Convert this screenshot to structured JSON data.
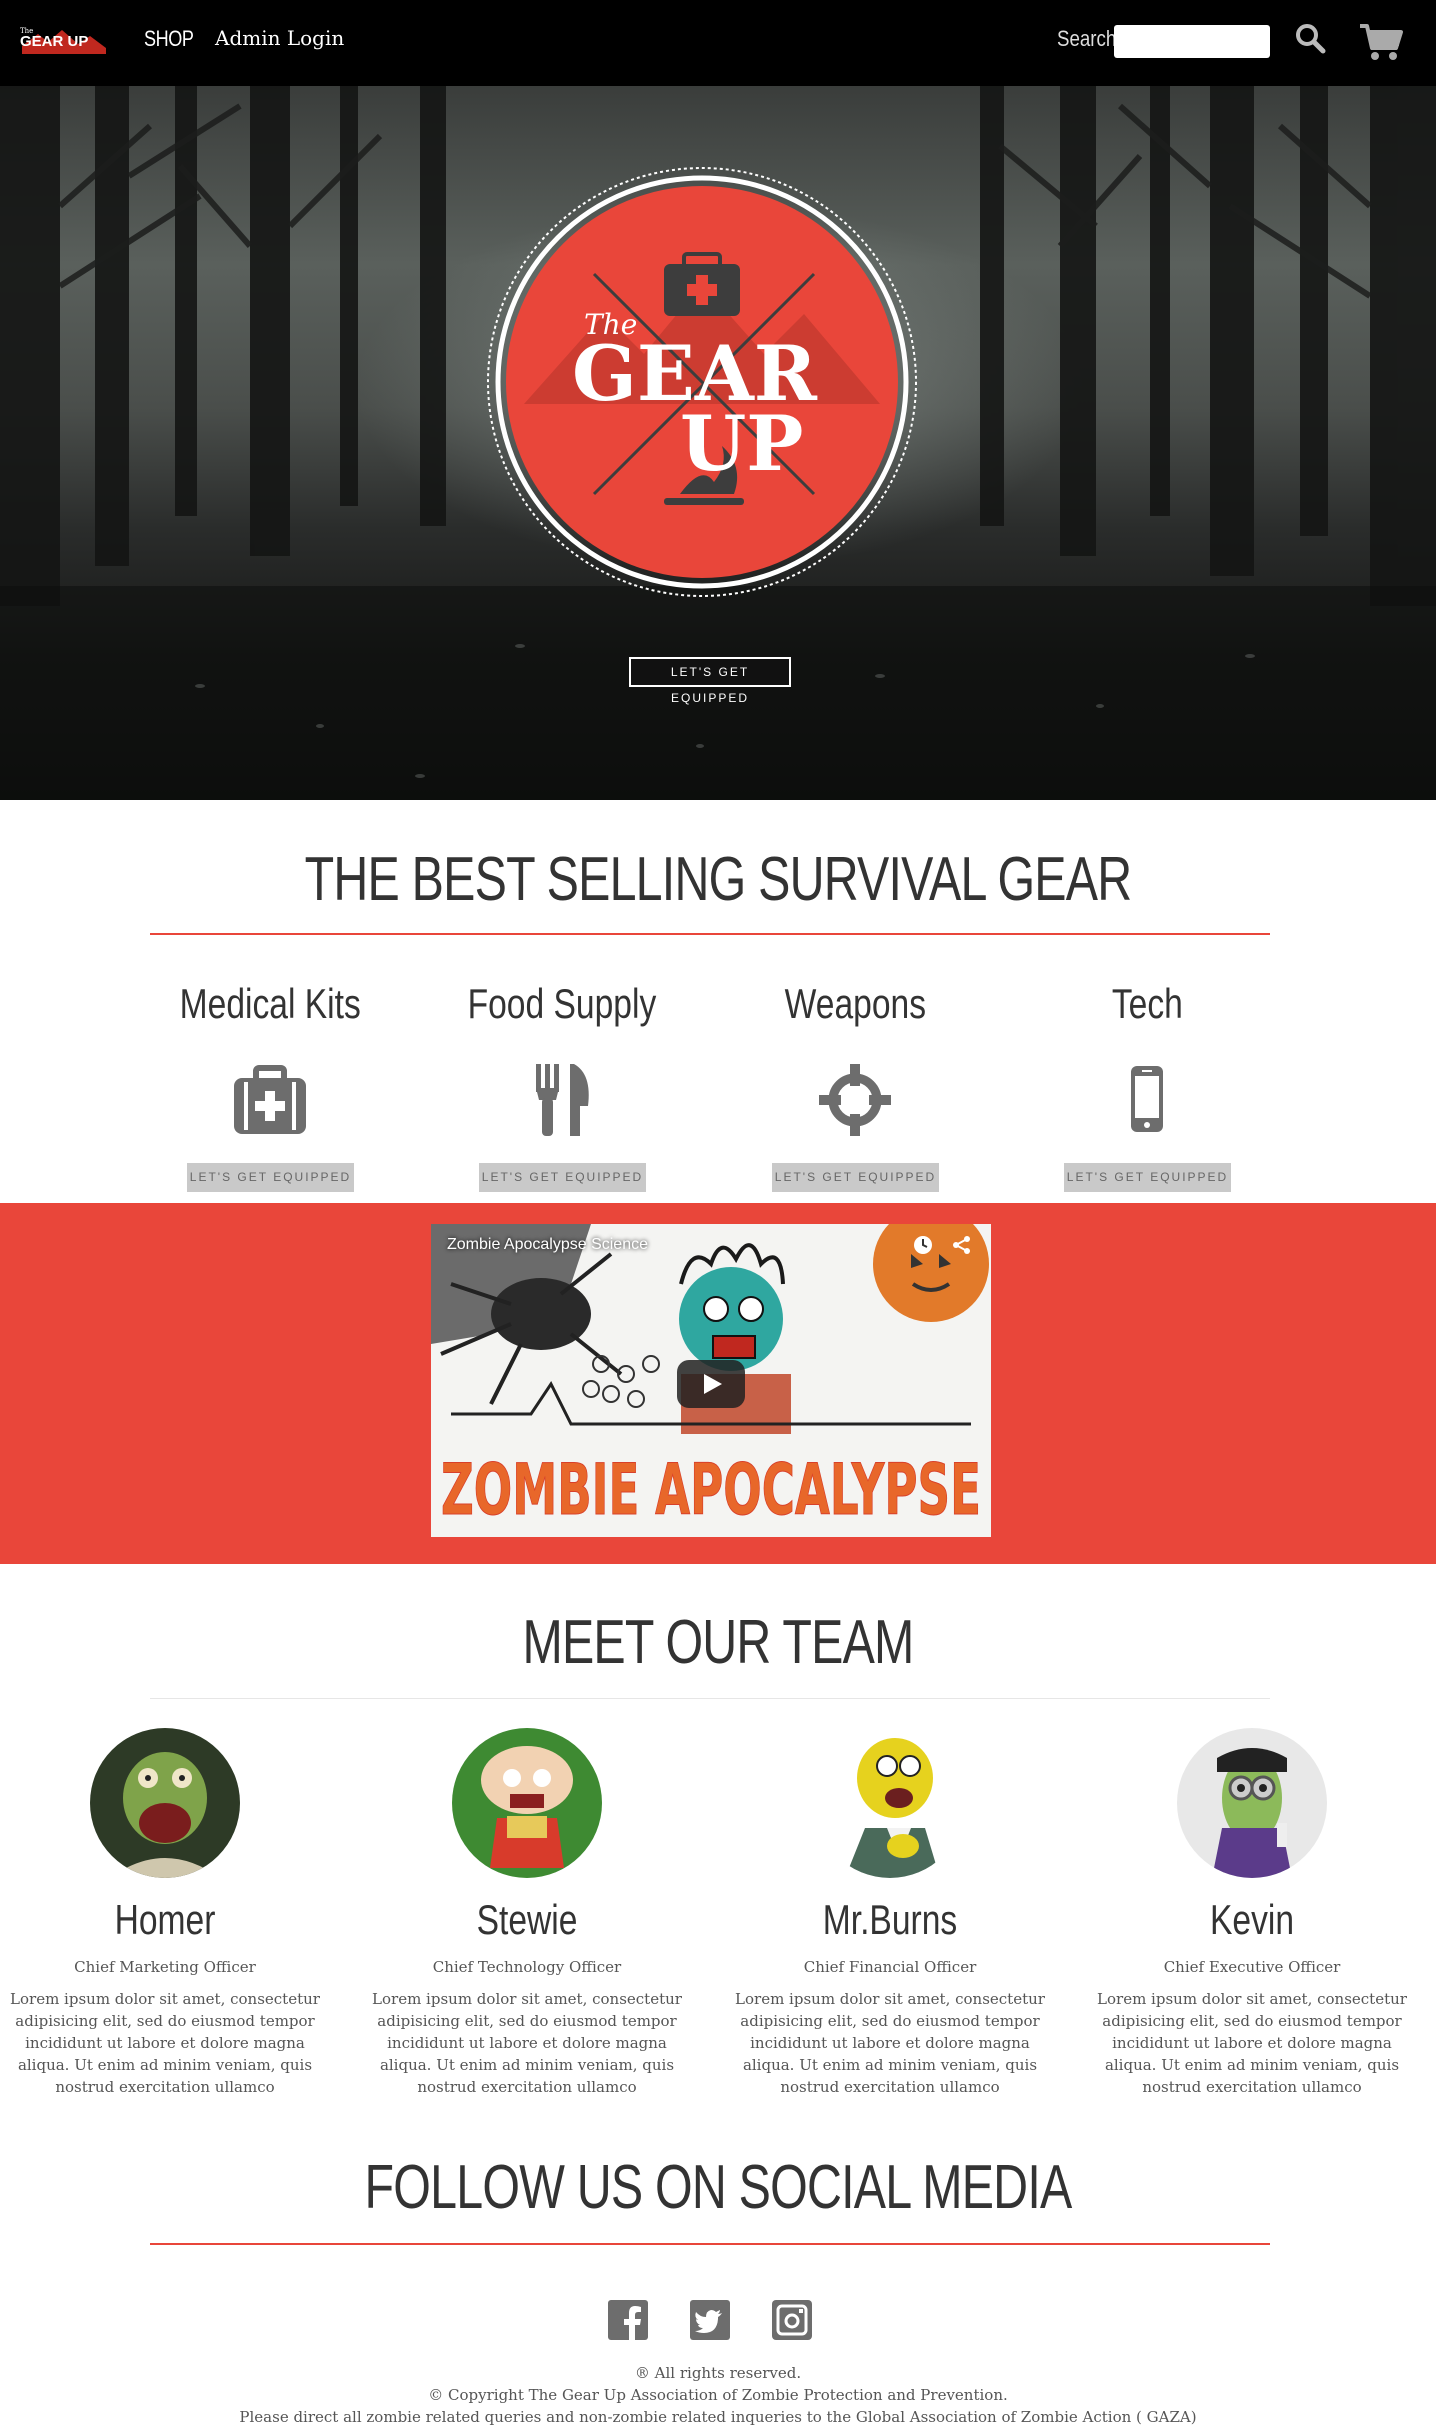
{
  "nav": {
    "logo_text": "GEAR UP",
    "logo_small": "The",
    "shop": "SHOP",
    "admin": "Admin Login",
    "search_label": "Search",
    "search_placeholder": ""
  },
  "hero": {
    "emblem_small": "The",
    "emblem_line1": "GEAR",
    "emblem_line2": "UP",
    "cta": "LET'S GET EQUIPPED"
  },
  "best_selling": {
    "heading": "THE BEST SELLING SURVIVAL GEAR",
    "categories": [
      {
        "title": "Medical Kits",
        "icon": "medkit-icon",
        "button": "LET'S GET EQUIPPED"
      },
      {
        "title": "Food Supply",
        "icon": "fork-knife-icon",
        "button": "LET'S GET EQUIPPED"
      },
      {
        "title": "Weapons",
        "icon": "crosshair-icon",
        "button": "LET'S GET EQUIPPED"
      },
      {
        "title": "Tech",
        "icon": "phone-icon",
        "button": "LET'S GET EQUIPPED"
      }
    ]
  },
  "video": {
    "title": "Zombie Apocalypse Science",
    "art_text": "ZOMBIE APOCALYPSE"
  },
  "team": {
    "heading": "MEET OUR TEAM",
    "members": [
      {
        "name": "Homer",
        "role": "Chief Marketing Officer",
        "bio": "Lorem ipsum dolor sit amet, consectetur adipisicing elit, sed do eiusmod tempor incididunt ut labore et dolore magna aliqua. Ut enim ad minim veniam, quis nostrud exercitation ullamco"
      },
      {
        "name": "Stewie",
        "role": "Chief Technology Officer",
        "bio": "Lorem ipsum dolor sit amet, consectetur adipisicing elit, sed do eiusmod tempor incididunt ut labore et dolore magna aliqua. Ut enim ad minim veniam, quis nostrud exercitation ullamco"
      },
      {
        "name": "Mr.Burns",
        "role": "Chief Financial Officer",
        "bio": "Lorem ipsum dolor sit amet, consectetur adipisicing elit, sed do eiusmod tempor incididunt ut labore et dolore magna aliqua. Ut enim ad minim veniam, quis nostrud exercitation ullamco"
      },
      {
        "name": "Kevin",
        "role": "Chief Executive Officer",
        "bio": "Lorem ipsum dolor sit amet, consectetur adipisicing elit, sed do eiusmod tempor incididunt ut labore et dolore magna aliqua. Ut enim ad minim veniam, quis nostrud exercitation ullamco"
      }
    ]
  },
  "social": {
    "heading": "FOLLOW US ON SOCIAL MEDIA",
    "icons": [
      "facebook-icon",
      "twitter-icon",
      "instagram-icon"
    ]
  },
  "footer": {
    "rights": "® All rights reserved.",
    "copyright": "© Copyright The Gear Up Association of Zombie Protection and Prevention.",
    "contact": "Please direct all zombie related queries and non-zombie related inqueries to the Global Association of Zombie Action ( GAZA)"
  },
  "colors": {
    "accent": "#e9463a",
    "navbar": "#000000",
    "button_grey": "#c9c9c9"
  }
}
